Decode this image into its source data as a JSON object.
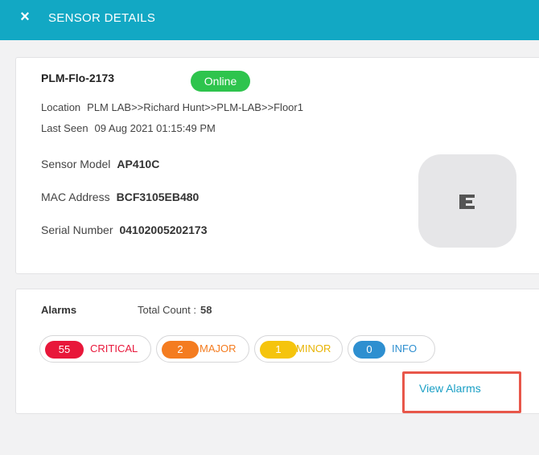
{
  "header": {
    "close_icon": "×",
    "title": "SENSOR DETAILS",
    "bg_color": "#12a8c4"
  },
  "sensor": {
    "name": "PLM-Flo-2173",
    "status": "Online",
    "status_color": "#2ec44d",
    "location_label": "Location",
    "location_value": "PLM LAB>>Richard Hunt>>PLM-LAB>>Floor1",
    "last_seen_label": "Last Seen",
    "last_seen_value": "09 Aug 2021 01:15:49 PM",
    "model_label": "Sensor Model",
    "model_value": "AP410C",
    "mac_label": "MAC Address",
    "mac_value": "BCF3105EB480",
    "serial_label": "Serial Number",
    "serial_value": "04102005202173",
    "image_icon": "extreme-networks-logo-icon"
  },
  "alarms": {
    "title": "Alarms",
    "total_label": "Total Count",
    "total_separator": ":",
    "total_value": "58",
    "badges": [
      {
        "count": "55",
        "label": "CRITICAL",
        "color": "#e8173a"
      },
      {
        "count": "2",
        "label": "MAJOR",
        "color": "#f47c20"
      },
      {
        "count": "1",
        "label": "MINOR",
        "color": "#f5c40d"
      },
      {
        "count": "0",
        "label": "INFO",
        "color": "#2e8fd0"
      }
    ],
    "view_link": "View Alarms"
  }
}
